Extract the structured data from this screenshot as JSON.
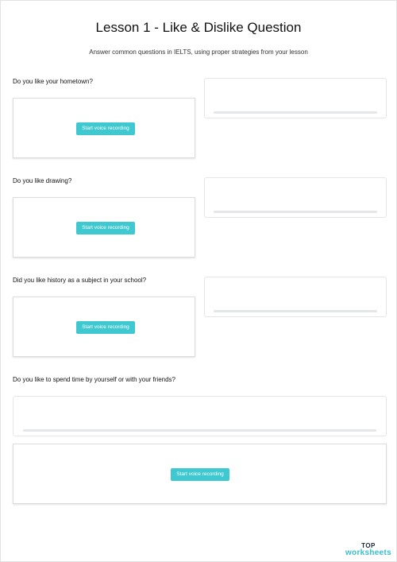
{
  "worksheet": {
    "title": "Lesson 1 - Like & Dislike Question",
    "subtitle": "Answer common questions in IELTS, using proper strategies from your lesson"
  },
  "questions": [
    {
      "text": "Do you like your hometown?",
      "button_label": "Start voice recording"
    },
    {
      "text": "Do you like drawing?",
      "button_label": "Start voice recording"
    },
    {
      "text": "Did you like history as a subject in your school?",
      "button_label": "Start voice recording"
    },
    {
      "text": "Do you like to spend time by yourself or with your friends?",
      "button_label": "Start voice recording"
    }
  ],
  "brand": {
    "top": "TOP",
    "name": "worksheets",
    "accent": "#3bbdc9"
  },
  "colors": {
    "button": "#3fc8cf"
  }
}
